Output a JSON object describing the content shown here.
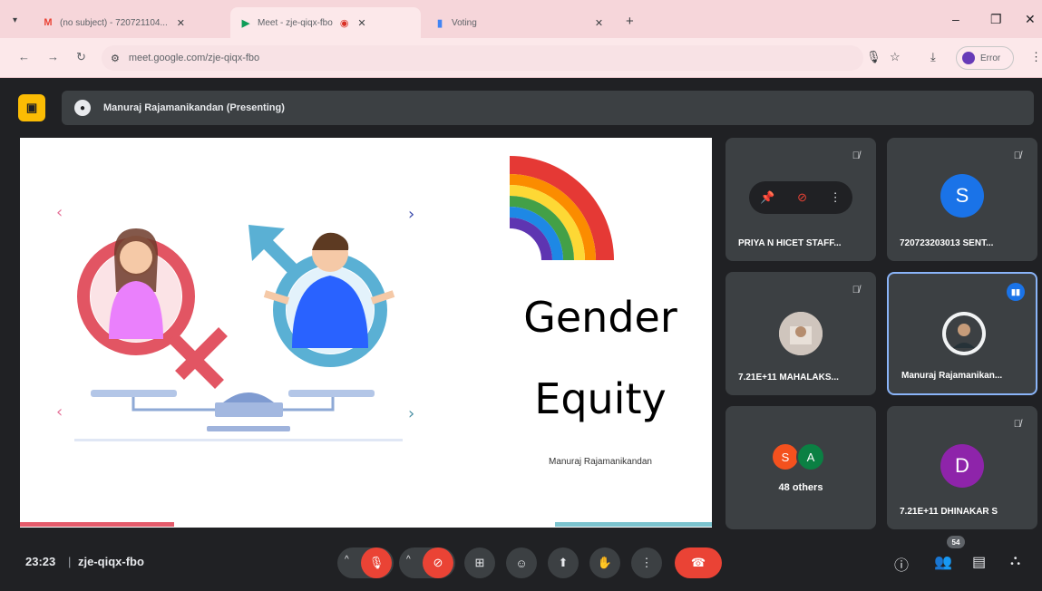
{
  "browser": {
    "tabs": [
      {
        "icon": "gmail-icon",
        "title": "(no subject) - 720721104... ",
        "active": false
      },
      {
        "icon": "meet-icon",
        "title": "Meet - zje-qiqx-fbo",
        "active": true
      },
      {
        "icon": "voting-icon",
        "title": "Voting",
        "active": false
      }
    ],
    "url": "meet.google.com/zje-qiqx-fbo",
    "profile_label": "Error"
  },
  "meet": {
    "presenting_label": "Manuraj Rajamanikandan (Presenting)",
    "slide": {
      "title_line1": "Gender",
      "title_line2": "Equity",
      "author": "Manuraj Rajamanikandan"
    },
    "tiles": [
      {
        "name": "PRIYA N HICET STAFF...",
        "muted": true,
        "hover_controls": true
      },
      {
        "name": "720723203013 SENT...",
        "initial": "S",
        "avatar_color": "#1a73e8",
        "muted": true
      },
      {
        "name": "7.21E+11 MAHALAKS...",
        "muted": true
      },
      {
        "name": "Manuraj Rajamanikan...",
        "speaking": true
      },
      {
        "name": "48 others",
        "others_initials": [
          "S",
          "A"
        ],
        "others_colors": [
          "#f4511e",
          "#0b8043"
        ]
      },
      {
        "name": "7.21E+11 DHINAKAR S",
        "initial": "D",
        "avatar_color": "#8e24aa",
        "muted": true
      }
    ],
    "controls": {
      "time": "23:23",
      "meeting_code": "zje-qiqx-fbo",
      "people_count": "54"
    }
  },
  "colors": {
    "accent_red": "#ea4335",
    "present_yellow": "#fbbc04",
    "speaker_border": "#8ab4f8"
  }
}
